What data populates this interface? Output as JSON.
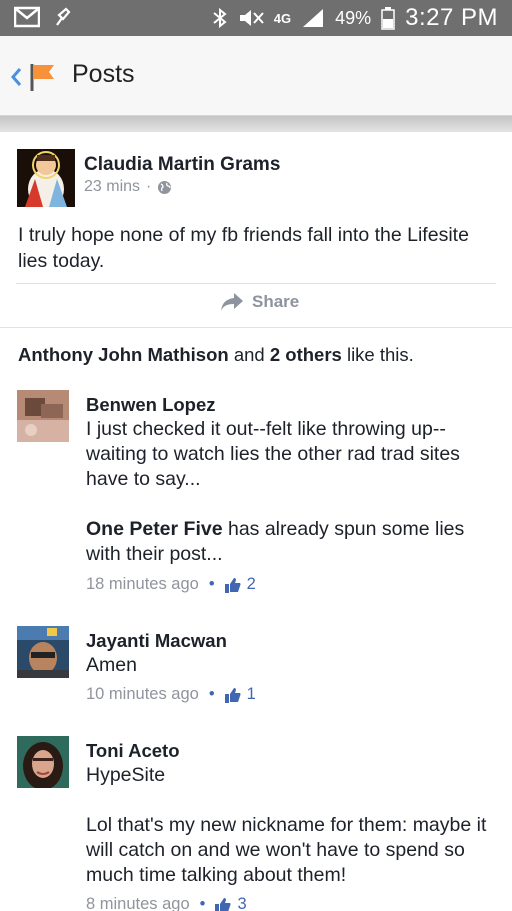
{
  "status_bar": {
    "network": "4G",
    "battery": "49%",
    "time": "3:27 PM"
  },
  "header": {
    "title": "Posts"
  },
  "post": {
    "author": "Claudia Martin Grams",
    "time": "23 mins",
    "separator": "·",
    "text": "I truly hope none of my fb friends fall into the Lifesite lies today.",
    "share_label": "Share"
  },
  "likes": {
    "name": "Anthony John Mathison",
    "and": "and",
    "others": "2 others",
    "suffix": "like this."
  },
  "comments": [
    {
      "name": "Benwen Lopez",
      "text_line1": "I just checked it out--felt like throwing up--waiting to watch lies the other rad trad sites have to say...",
      "mention": "One Peter Five",
      "text_line2": " has already spun some lies with their post...",
      "time": "18 minutes ago",
      "likes": "2"
    },
    {
      "name": "Jayanti Macwan",
      "text": "Amen",
      "time": "10 minutes ago",
      "likes": "1"
    },
    {
      "name": "Toni Aceto",
      "text": "HypeSite",
      "text2": "Lol that's my new nickname for them: maybe it will catch on and we won't have to spend so much time talking about them!",
      "time": "8 minutes ago",
      "likes": "3"
    }
  ],
  "colors": {
    "status_bar": "#6f6f6f",
    "link_blue": "#4267b2",
    "meta_gray": "#90949c",
    "flag_orange": "#f7923a"
  }
}
